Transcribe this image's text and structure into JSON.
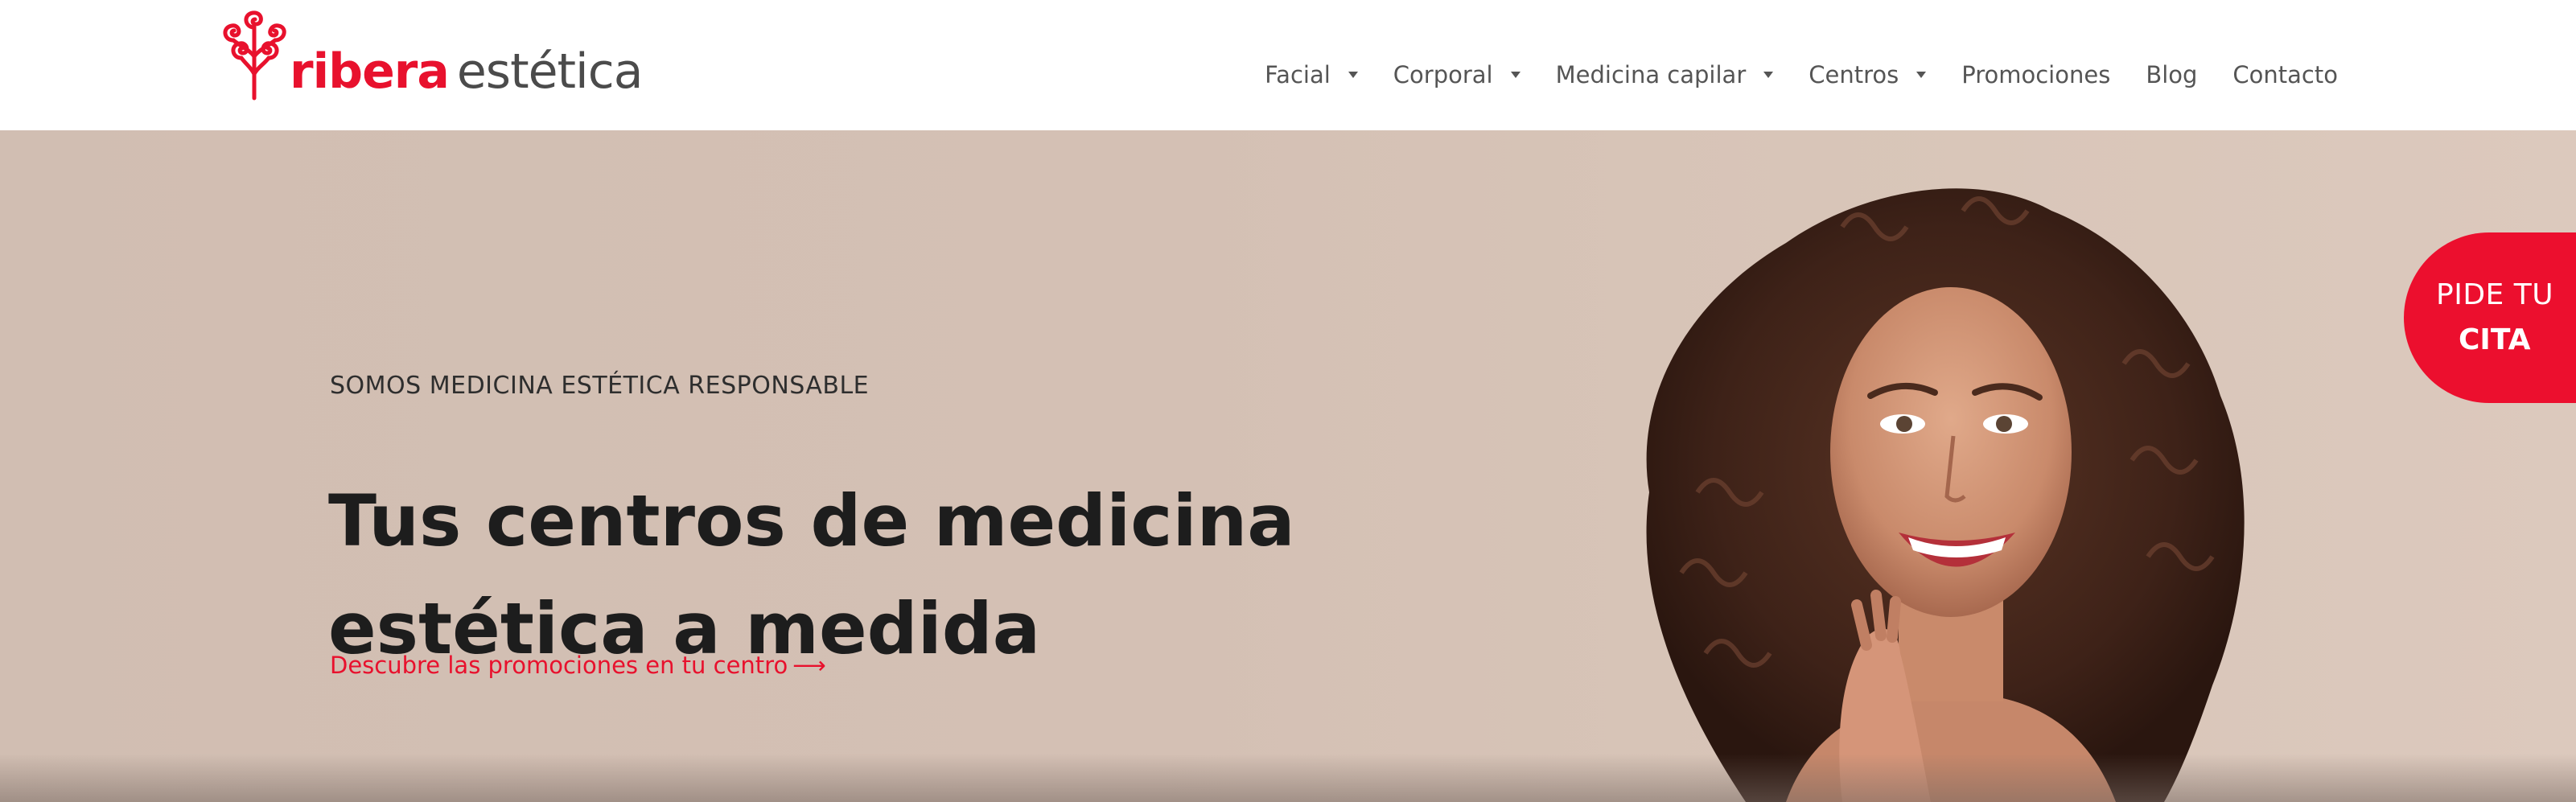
{
  "brand": {
    "name": "ribera",
    "tagline": "estética",
    "primary_color": "#e8112d"
  },
  "nav": {
    "items": [
      {
        "label": "Facial",
        "has_dropdown": true
      },
      {
        "label": "Corporal",
        "has_dropdown": true
      },
      {
        "label": "Medicina capilar",
        "has_dropdown": true
      },
      {
        "label": "Centros",
        "has_dropdown": true
      },
      {
        "label": "Promociones",
        "has_dropdown": false
      },
      {
        "label": "Blog",
        "has_dropdown": false
      },
      {
        "label": "Contacto",
        "has_dropdown": false
      }
    ]
  },
  "hero": {
    "eyebrow": "SOMOS MEDICINA ESTÉTICA RESPONSABLE",
    "title_line1": "Tus centros de medicina",
    "title_line2": "estética a medida",
    "link_label": "Descubre las promociones en tu centro",
    "link_arrow": "⟶",
    "background_color": "#d4c0b4"
  },
  "cta": {
    "line1": "PIDE TU",
    "line2": "CITA",
    "color": "#ec0f2e"
  }
}
